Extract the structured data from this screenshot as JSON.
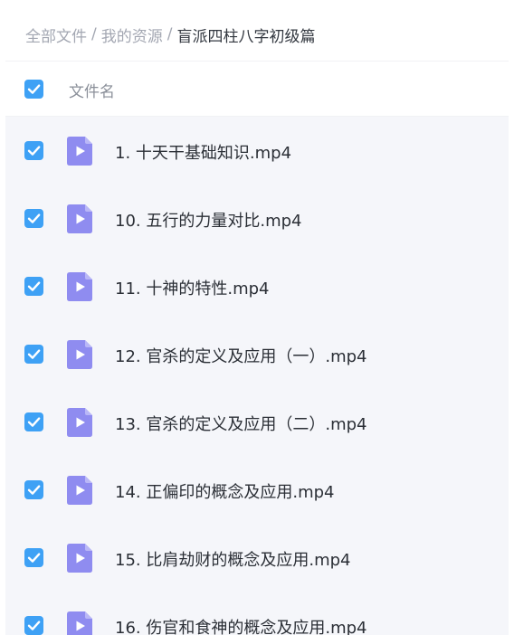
{
  "breadcrumb": {
    "items": [
      "全部文件",
      "我的资源"
    ],
    "separator": "/",
    "current": "盲派四柱八字初级篇"
  },
  "list": {
    "header": {
      "label": "文件名",
      "checked": true
    },
    "files": [
      {
        "name": "1. 十天干基础知识.mp4",
        "checked": true,
        "icon": "video-file-icon"
      },
      {
        "name": "10. 五行的力量对比.mp4",
        "checked": true,
        "icon": "video-file-icon"
      },
      {
        "name": "11. 十神的特性.mp4",
        "checked": true,
        "icon": "video-file-icon"
      },
      {
        "name": "12. 官杀的定义及应用（一）.mp4",
        "checked": true,
        "icon": "video-file-icon"
      },
      {
        "name": "13. 官杀的定义及应用（二）.mp4",
        "checked": true,
        "icon": "video-file-icon"
      },
      {
        "name": "14. 正偏印的概念及应用.mp4",
        "checked": true,
        "icon": "video-file-icon"
      },
      {
        "name": "15. 比肩劫财的概念及应用.mp4",
        "checked": true,
        "icon": "video-file-icon"
      },
      {
        "name": "16. 伤官和食神的概念及应用.mp4",
        "checked": true,
        "icon": "video-file-icon"
      }
    ]
  },
  "colors": {
    "accent": "#3ea1f5",
    "icon": "#8f8cf0",
    "listBackground": "#f5f6fa"
  }
}
